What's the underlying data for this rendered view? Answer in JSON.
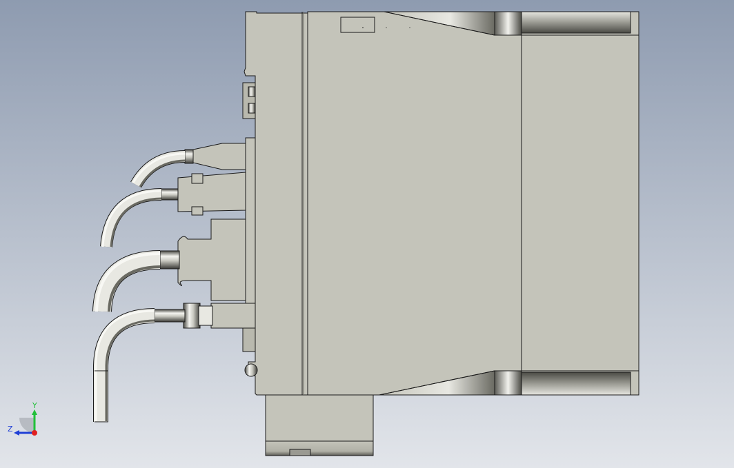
{
  "viewport": {
    "background_top": "#8e9bb0",
    "background_bottom": "#e2e5ea"
  },
  "model": {
    "body_color": "#c4c4ba",
    "body_shade": "#b9b9ae",
    "outline_color": "#1a1a1a",
    "cable_color": "#b8b8b0",
    "cable_highlight": "#f4f4f0",
    "cable_shadow": "#3a3a36",
    "connector_count": 4
  },
  "triad": {
    "y_label": "Y",
    "z_label": "Z",
    "y_color": "#22c03a",
    "z_color": "#1f3fd6",
    "origin_color": "#e02020"
  }
}
